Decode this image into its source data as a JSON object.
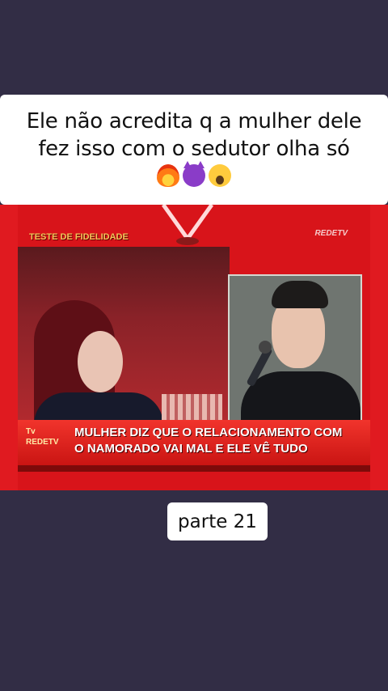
{
  "caption": {
    "line1": "Ele não acredita q a mulher dele",
    "line2": "fez isso com o sedutor olha só",
    "emojis": [
      "fire-emoji",
      "smiling-devil-emoji",
      "screaming-face-emoji"
    ]
  },
  "video": {
    "show_tag": "TESTE DE FIDELIDADE",
    "channel_logo": "REDETV",
    "ticker_logo": "Tv\nREDETV",
    "ticker_line1": "MULHER DIZ QUE O RELACIONAMENTO COM",
    "ticker_line2": "O NAMORADO VAI MAL E ELE VÊ TUDO"
  },
  "part_label": "parte 21",
  "colors": {
    "background": "#322d45",
    "video_red": "#e01a20",
    "caption_bg": "#ffffff"
  }
}
